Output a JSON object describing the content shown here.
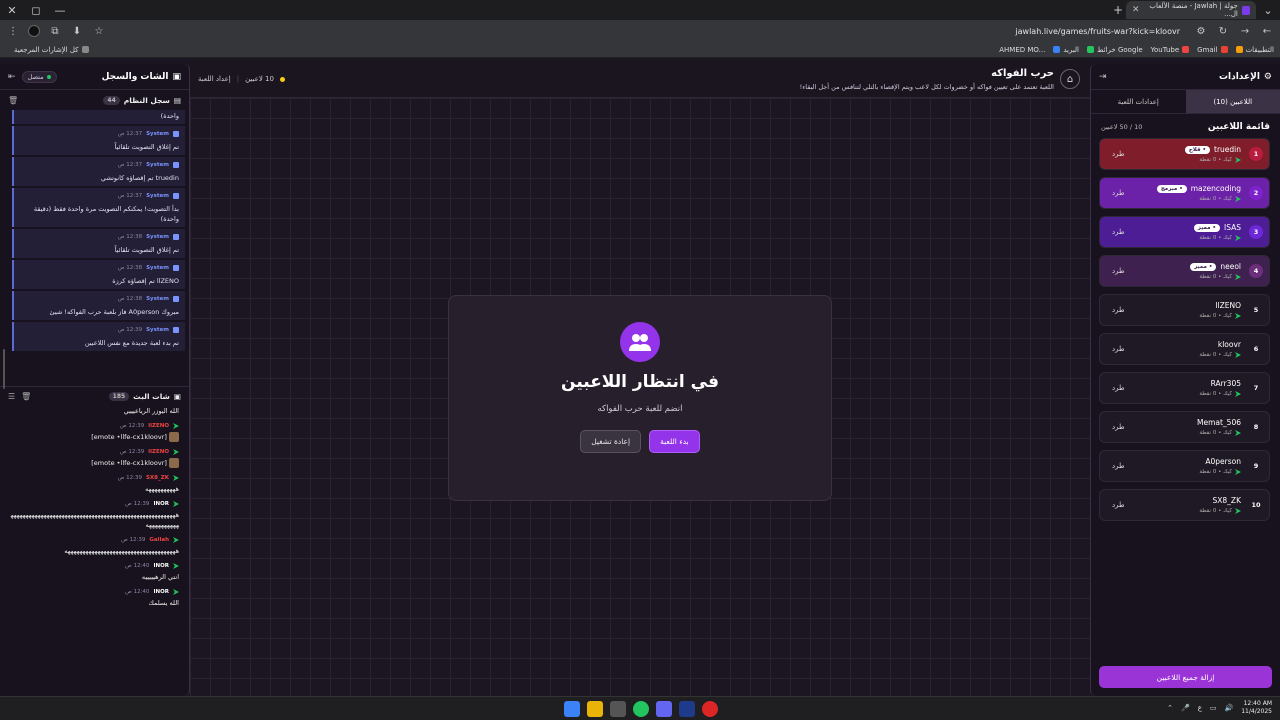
{
  "browser": {
    "tab_title": "جولة | Jawlah - منصة الألعاب ال...",
    "url": "jawlah.live/games/fruits-war?kick=kloovr",
    "bookmarks": [
      "التطبيقات",
      "Gmail",
      "YouTube",
      "خرائط Google",
      "البريد",
      "AHMED MO..."
    ],
    "all_bookmarks": "كل الإشارات المرجعية"
  },
  "chat_panel": {
    "title": "الشات والسجل",
    "status": "متصل",
    "syslog": {
      "title": "سجل النظام",
      "count": "44",
      "partial": "واحدة)",
      "messages": [
        {
          "time": "12:37 ص",
          "author": "System",
          "text": "تم إغلاق التصويت تلقائياً"
        },
        {
          "time": "12:37 ص",
          "author": "System",
          "text": "truedin تم إقصاؤه كانوتشي"
        },
        {
          "time": "12:37 ص",
          "author": "System",
          "text": "بدأ التصويت! يمكنكم التصويت مرة واحدة فقط (دقيقة واحدة)"
        },
        {
          "time": "12:38 ص",
          "author": "System",
          "text": "تم إغلاق التصويت تلقائياً"
        },
        {
          "time": "12:38 ص",
          "author": "System",
          "text": "llZENO تم إقصاؤه كرزة"
        },
        {
          "time": "12:38 ص",
          "author": "System",
          "text": "مبروك A0person فاز بلعبة حرب الفواكه! شيئ"
        },
        {
          "time": "12:39 ص",
          "author": "System",
          "text": "تم بدء لعبة جديدة مع نفس اللاعبين"
        }
      ]
    },
    "live": {
      "title": "شات البث",
      "count": "185",
      "top": "الله اليوزر الرياعيييي",
      "messages": [
        {
          "time": "12:39 ص",
          "author": "llZENO",
          "color": "#ef4444",
          "text": "[emote •llfe-cx1kloovr]",
          "emote": true
        },
        {
          "time": "12:39 ص",
          "author": "llZENO",
          "color": "#ef4444",
          "text": "[emote •llfe-cx1kloovr]",
          "emote": true
        },
        {
          "time": "12:39 ص",
          "author": "SX8_ZK",
          "color": "#ef4444",
          "text": "ههههههههههه"
        },
        {
          "time": "12:39 ص",
          "author": "INOR",
          "color": "#ffffff",
          "text": "ههههههههههههههههههههههههههههههههههههههههههههههههههههههههههههههههههه"
        },
        {
          "time": "12:39 ص",
          "author": "Gallah",
          "color": "#ef4444",
          "text": "هههههههههههههههههههههههههههههههههههههه"
        },
        {
          "time": "12:40 ص",
          "author": "INOR",
          "color": "#ffffff",
          "text": "انتي الرهيييييه"
        },
        {
          "time": "12:40 ص",
          "author": "INOR",
          "color": "#ffffff",
          "text": "الله يسلمك"
        }
      ]
    }
  },
  "game": {
    "title": "حرب الفواكه",
    "description": "اللعبة تعتمد على تعيين فواكه أو خضروات لكل لاعب ويتم الإقصاء بالتلي لتنافس من أجل البقاء!",
    "players_count": "10 لاعبين",
    "settings_link": "إعداد اللعبة",
    "waiting_title": "في انتظار اللاعبين",
    "waiting_sub": "انضم للعبة حرب الفواكه",
    "start_label": "بدء اللعبة",
    "restart_label": "إعادة تشغيل"
  },
  "settings_panel": {
    "title": "الإعدادات",
    "tab_players": "اللاعبين (10)",
    "tab_settings": "إعدادات اللعبة",
    "list_title": "قائمة اللاعبين",
    "list_count": "10 / 50 لاعبين",
    "kick_label": "طرد",
    "sub_label": "كيك • 0 نقطة",
    "players": [
      {
        "num": "1",
        "name": "truedin",
        "badge": "قلاج",
        "bg": "#7f1d2b",
        "numbg": "#b91c3c"
      },
      {
        "num": "2",
        "name": "mazencoding",
        "badge": "مبرمج",
        "bg": "#6b21a8",
        "numbg": "#7e22ce"
      },
      {
        "num": "3",
        "name": "ISAS",
        "badge": "مميز",
        "bg": "#4c1d95",
        "numbg": "#6d28d9"
      },
      {
        "num": "4",
        "name": "neeol",
        "badge": "مميز",
        "bg": "#3f2150",
        "numbg": "#6b2f7c"
      },
      {
        "num": "5",
        "name": "llZENO",
        "badge": "",
        "bg": "#1e1924",
        "numbg": "transparent"
      },
      {
        "num": "6",
        "name": "kloovr",
        "badge": "",
        "bg": "#1e1924",
        "numbg": "transparent"
      },
      {
        "num": "7",
        "name": "RArr305",
        "badge": "",
        "bg": "#1e1924",
        "numbg": "transparent"
      },
      {
        "num": "8",
        "name": "Memat_506",
        "badge": "",
        "bg": "#1e1924",
        "numbg": "transparent"
      },
      {
        "num": "9",
        "name": "A0person",
        "badge": "",
        "bg": "#1e1924",
        "numbg": "transparent"
      },
      {
        "num": "10",
        "name": "SX8_ZK",
        "badge": "",
        "bg": "#1e1924",
        "numbg": "transparent"
      }
    ],
    "remove_all": "إزالة جميع اللاعبين"
  },
  "taskbar": {
    "time": "12:40 AM",
    "date": "11/4/2025",
    "lang": "ع"
  }
}
